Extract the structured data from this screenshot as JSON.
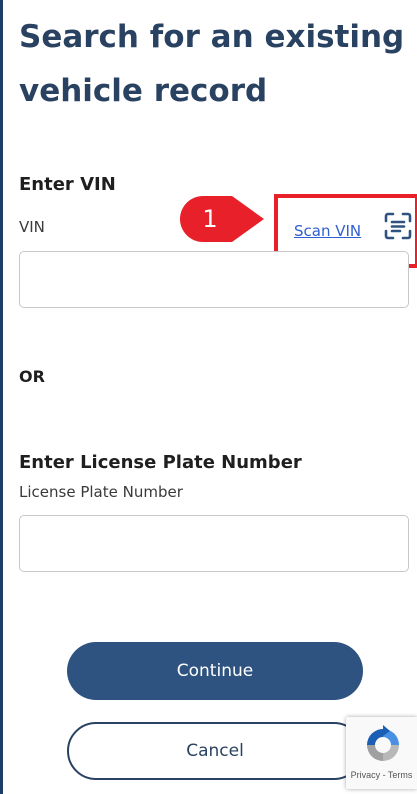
{
  "page": {
    "title": "Search for an existing vehicle record"
  },
  "vin_section": {
    "heading": "Enter VIN",
    "label": "VIN",
    "value": "",
    "scan_link": "Scan VIN",
    "scan_icon": "scan-document-icon"
  },
  "divider": {
    "text": "OR"
  },
  "plate_section": {
    "heading": "Enter License Plate Number",
    "label": "License Plate Number",
    "value": ""
  },
  "actions": {
    "continue_label": "Continue",
    "cancel_label": "Cancel"
  },
  "annotation": {
    "step_number": "1",
    "highlight_color": "#e8202a",
    "badge_color": "#e8202a"
  },
  "recaptcha": {
    "text": "Privacy - Terms",
    "icon": "recaptcha-icon"
  },
  "colors": {
    "title": "#2a4262",
    "primary_button": "#2f5380",
    "link": "#2f5fd0"
  }
}
